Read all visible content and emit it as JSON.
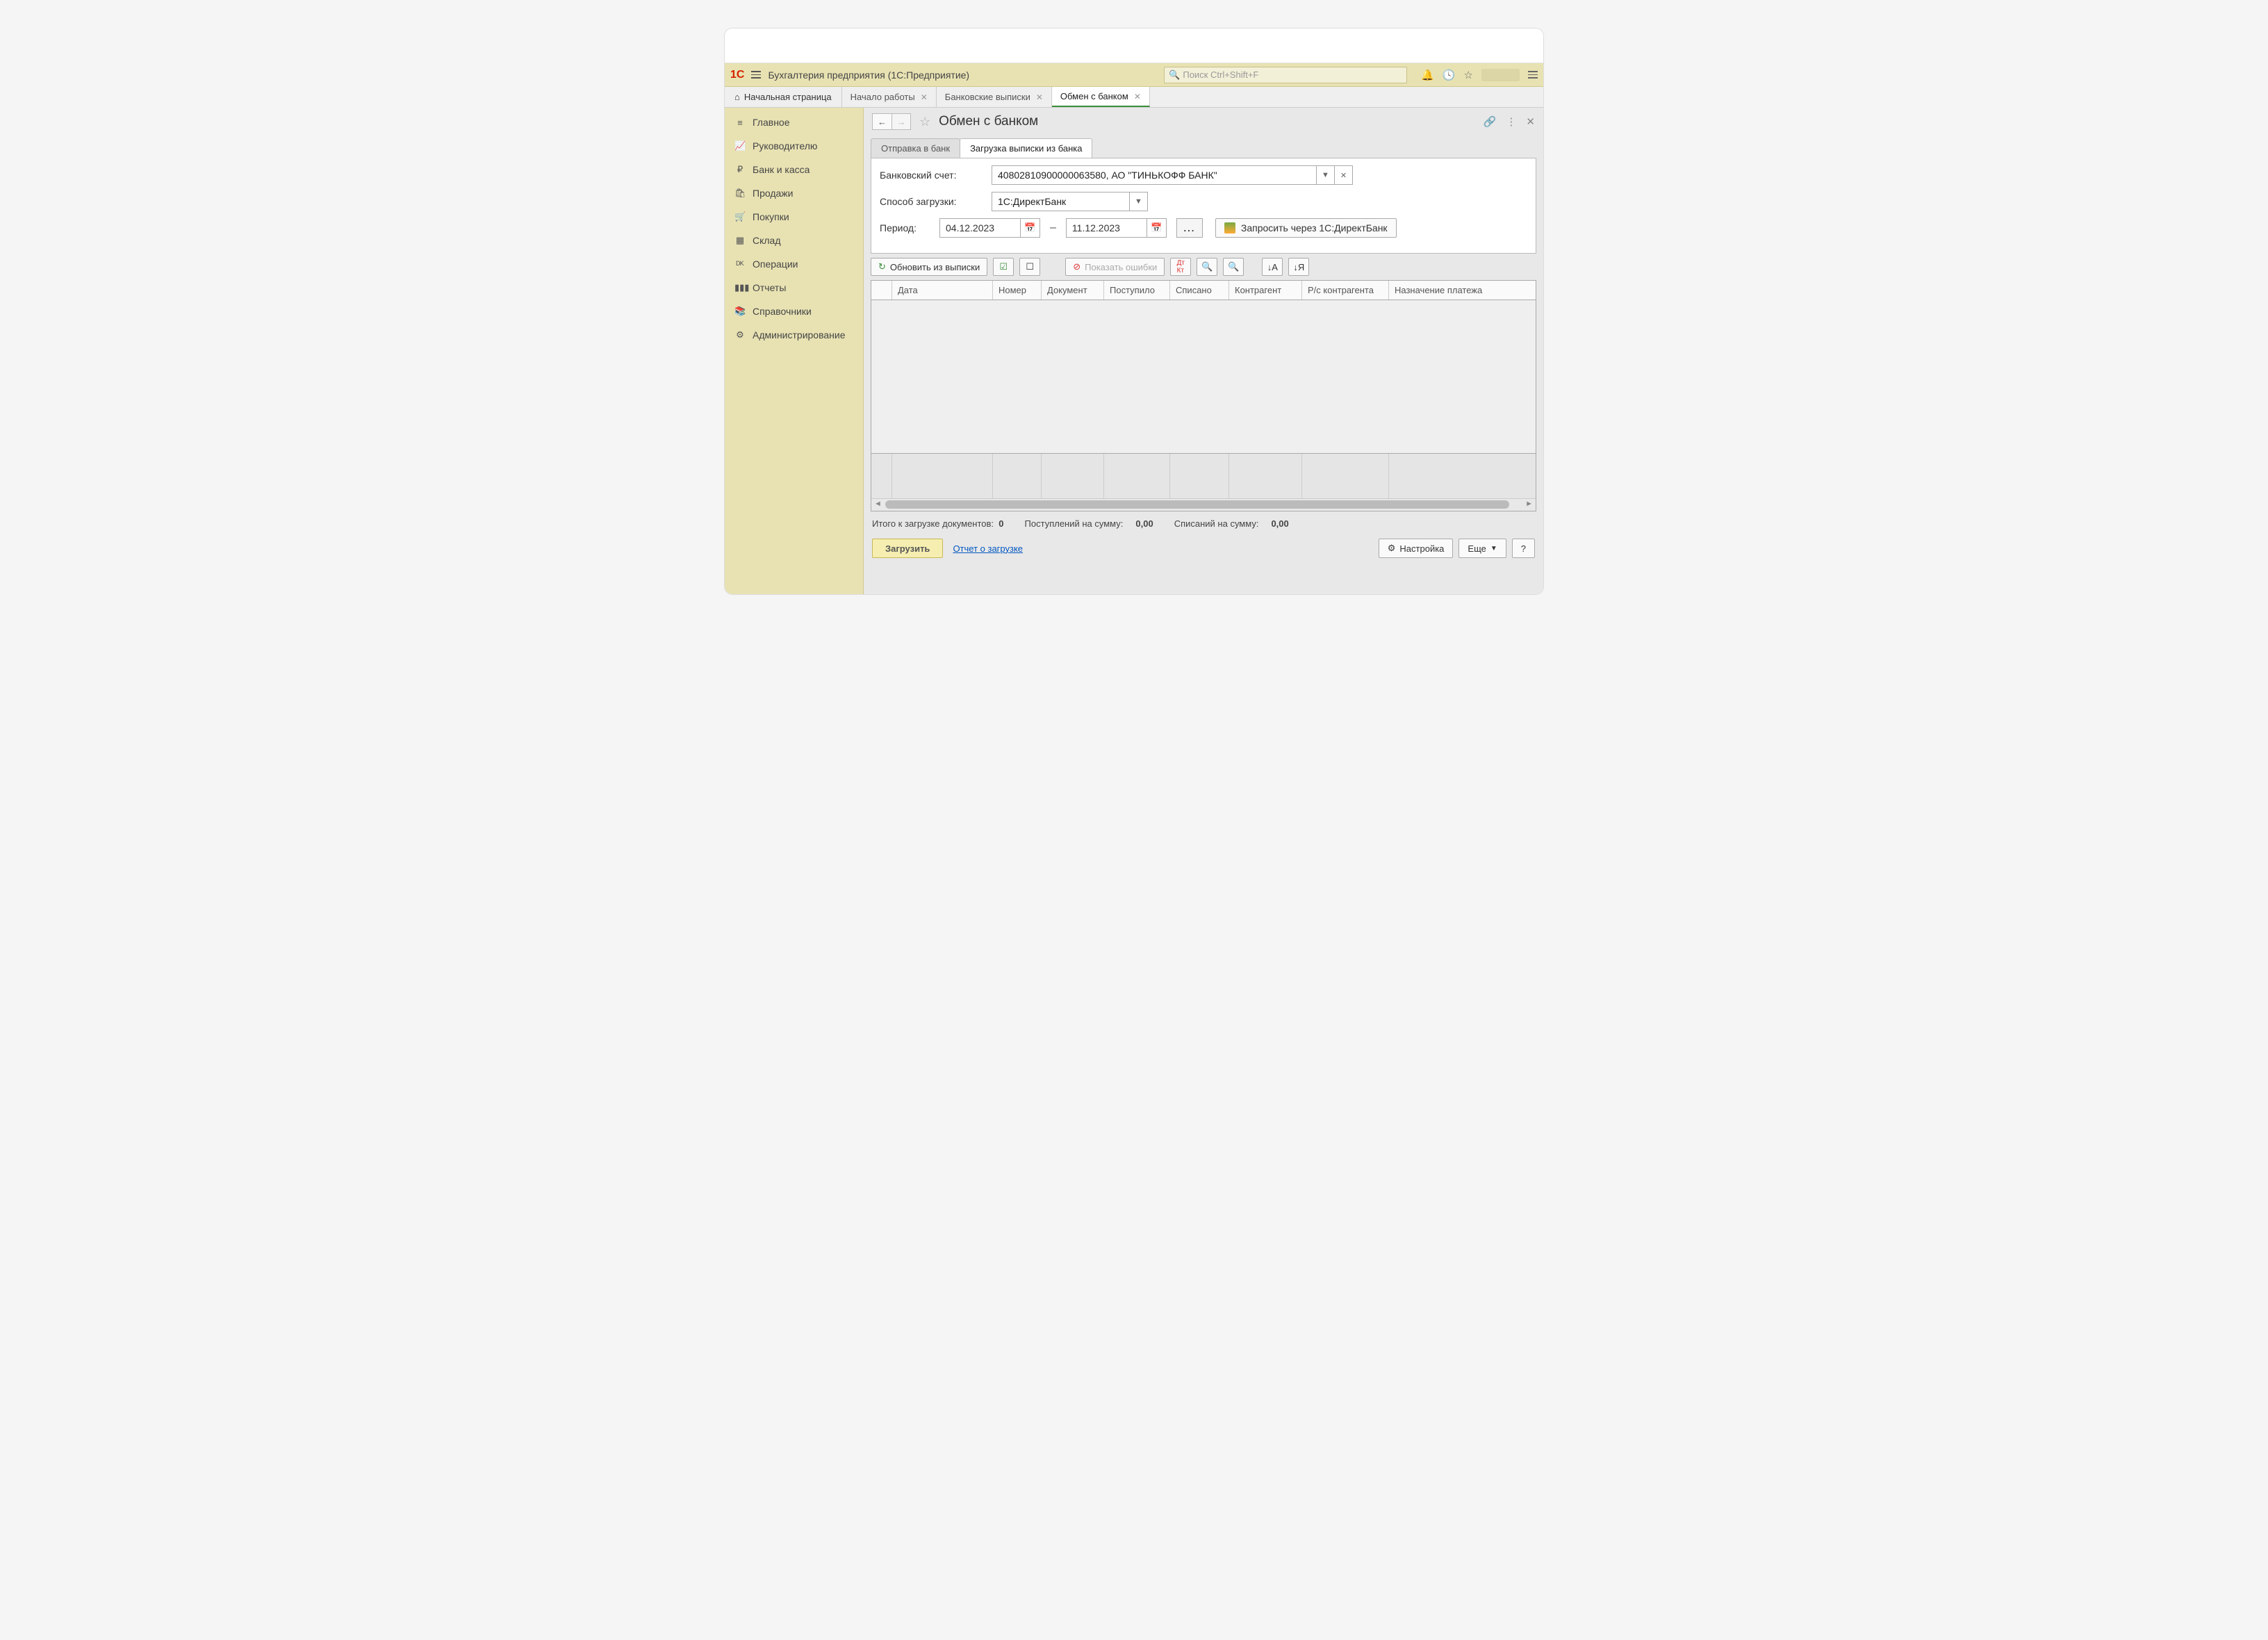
{
  "titlebar": {
    "logo": "1C",
    "app_name": "Бухгалтерия предприятия  (1С:Предприятие)",
    "search_placeholder": "Поиск Ctrl+Shift+F"
  },
  "tabs": {
    "home": "Начальная страница",
    "items": [
      {
        "label": "Начало работы",
        "active": false
      },
      {
        "label": "Банковские выписки",
        "active": false
      },
      {
        "label": "Обмен с банком",
        "active": true
      }
    ]
  },
  "sidebar": {
    "items": [
      {
        "icon": "≡",
        "label": "Главное"
      },
      {
        "icon": "📈",
        "label": "Руководителю"
      },
      {
        "icon": "₽",
        "label": "Банк и касса"
      },
      {
        "icon": "🛍",
        "label": "Продажи"
      },
      {
        "icon": "🛒",
        "label": "Покупки"
      },
      {
        "icon": "▦",
        "label": "Склад"
      },
      {
        "icon": "ᴰᴷ",
        "label": "Операции"
      },
      {
        "icon": "▮▮▮",
        "label": "Отчеты"
      },
      {
        "icon": "📚",
        "label": "Справочники"
      },
      {
        "icon": "⚙",
        "label": "Администрирование"
      }
    ]
  },
  "page": {
    "title": "Обмен с банком",
    "subtabs": {
      "send": "Отправка в банк",
      "load": "Загрузка выписки из банка"
    },
    "form": {
      "account_label": "Банковский счет:",
      "account_value": "40802810900000063580, АО \"ТИНЬКОФФ БАНК\"",
      "method_label": "Способ загрузки:",
      "method_value": "1С:ДиректБанк",
      "period_label": "Период:",
      "date_from": "04.12.2023",
      "date_to": "11.12.2023",
      "ellipsis": "...",
      "request_btn": "Запросить через 1С:ДиректБанк"
    },
    "toolbar": {
      "refresh": "Обновить из выписки",
      "show_errors": "Показать ошибки"
    },
    "table": {
      "columns": [
        "",
        "Дата",
        "Номер",
        "Документ",
        "Поступило",
        "Списано",
        "Контрагент",
        "Р/с контрагента",
        "Назначение платежа"
      ]
    },
    "summary": {
      "docs_label": "Итого к загрузке документов:",
      "docs_value": "0",
      "in_label": "Поступлений на сумму:",
      "in_value": "0,00",
      "out_label": "Списаний на сумму:",
      "out_value": "0,00"
    },
    "footer": {
      "load_btn": "Загрузить",
      "report_link": "Отчет о загрузке",
      "settings_btn": "Настройка",
      "more_btn": "Еще",
      "help_btn": "?"
    }
  }
}
